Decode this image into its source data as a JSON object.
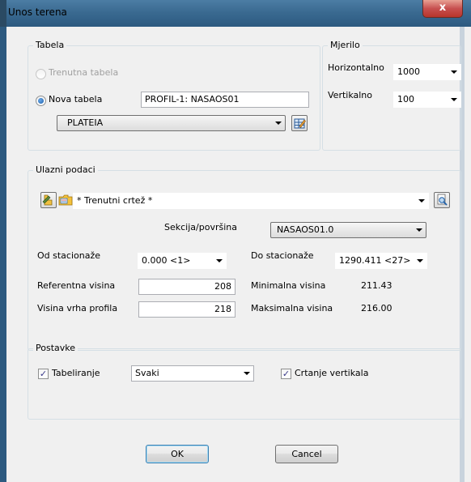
{
  "window": {
    "title": "Unos terena",
    "close_glyph": "x"
  },
  "tabela": {
    "legend": "Tabela",
    "radio_trenutna": "Trenutna tabela",
    "radio_nova": "Nova tabela",
    "nova_value": "PROFIL-1: NASAOS01",
    "combo_value": "PLATEIA"
  },
  "mjerilo": {
    "legend": "Mjerilo",
    "horizontalno_label": "Horizontalno",
    "horizontalno_value": "1000",
    "vertikalno_label": "Vertikalno",
    "vertikalno_value": "100"
  },
  "ulazni": {
    "legend": "Ulazni podaci",
    "source_value": "* Trenutni crtež *",
    "sekcija_label": "Sekcija/površina",
    "sekcija_value": "NASAOS01.0",
    "od_label": "Od stacionaže",
    "od_value": "0.000 <1>",
    "do_label": "Do stacionaže",
    "do_value": "1290.411 <27>",
    "ref_label": "Referentna visina",
    "ref_value": "208",
    "vrh_label": "Visina vrha profila",
    "vrh_value": "218",
    "min_label": "Minimalna visina",
    "min_value": "211.43",
    "max_label": "Maksimalna visina",
    "max_value": "216.00"
  },
  "postavke": {
    "legend": "Postavke",
    "tabeliranje_label": "Tabeliranje",
    "tabeliranje_checked": true,
    "svaki_value": "Svaki",
    "crtanje_label": "Crtanje vertikala",
    "crtanje_checked": true,
    "check_glyph": "✓"
  },
  "buttons": {
    "ok": "OK",
    "cancel": "Cancel"
  },
  "icons": {
    "edit": "edit-table-icon",
    "pick": "pick-drawing-icon",
    "folder": "folder-icon",
    "browse": "browse-icon"
  }
}
